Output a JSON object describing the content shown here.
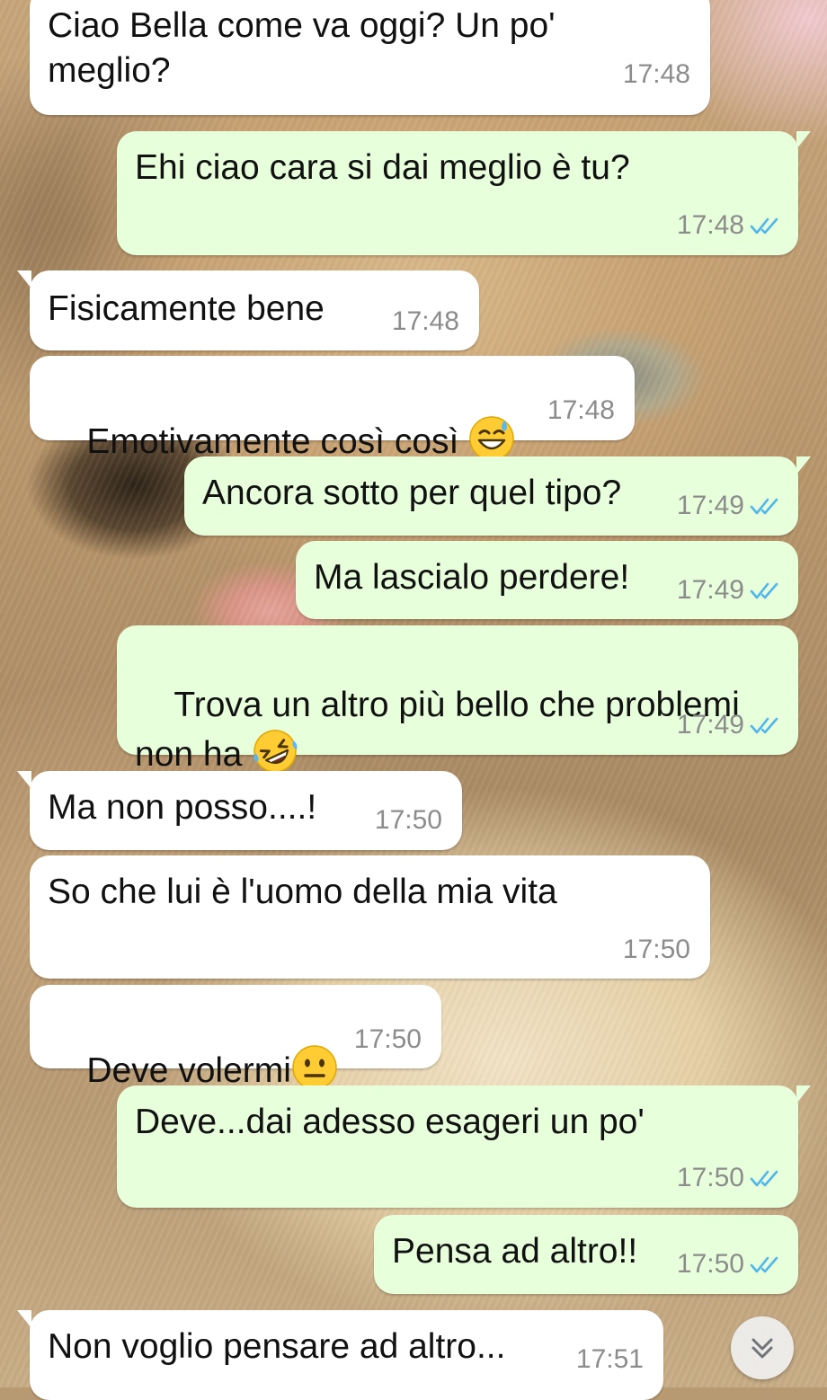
{
  "messages": [
    {
      "text": "Ciao Bella come va oggi? Un po'\nmeglio?",
      "time": "17:48",
      "direction": "in"
    },
    {
      "text": "Ehi ciao cara si dai meglio è tu?",
      "time": "17:48",
      "direction": "out",
      "status": "read"
    },
    {
      "text": "Fisicamente bene",
      "time": "17:48",
      "direction": "in"
    },
    {
      "text": "Emotivamente così così ",
      "time": "17:48",
      "direction": "in",
      "emoji": "grinning-sweat-emoji"
    },
    {
      "text": "Ancora sotto per quel tipo?",
      "time": "17:49",
      "direction": "out",
      "status": "read"
    },
    {
      "text": "Ma lascialo perdere!",
      "time": "17:49",
      "direction": "out",
      "status": "read"
    },
    {
      "text": "Trova un altro più bello che problemi\nnon ha ",
      "time": "17:49",
      "direction": "out",
      "status": "read",
      "emoji": "rofl-emoji"
    },
    {
      "text": "Ma non posso....!",
      "time": "17:50",
      "direction": "in"
    },
    {
      "text": "So che lui è l'uomo della mia vita",
      "time": "17:50",
      "direction": "in"
    },
    {
      "text": "Deve volermi",
      "time": "17:50",
      "direction": "in",
      "emoji": "neutral-face-emoji"
    },
    {
      "text": "Deve...dai adesso esageri un po'",
      "time": "17:50",
      "direction": "out",
      "status": "read"
    },
    {
      "text": "Pensa ad altro!!",
      "time": "17:50",
      "direction": "out",
      "status": "read"
    },
    {
      "text": "Non voglio pensare ad altro...",
      "time": "17:51",
      "direction": "in"
    }
  ],
  "colors": {
    "incoming_bubble": "#ffffff",
    "outgoing_bubble": "#e7ffdb",
    "read_ticks": "#4fb6ec",
    "timestamp": "#8c8c8c"
  },
  "scroll_button": {
    "icon": "double-chevron-down-icon"
  }
}
